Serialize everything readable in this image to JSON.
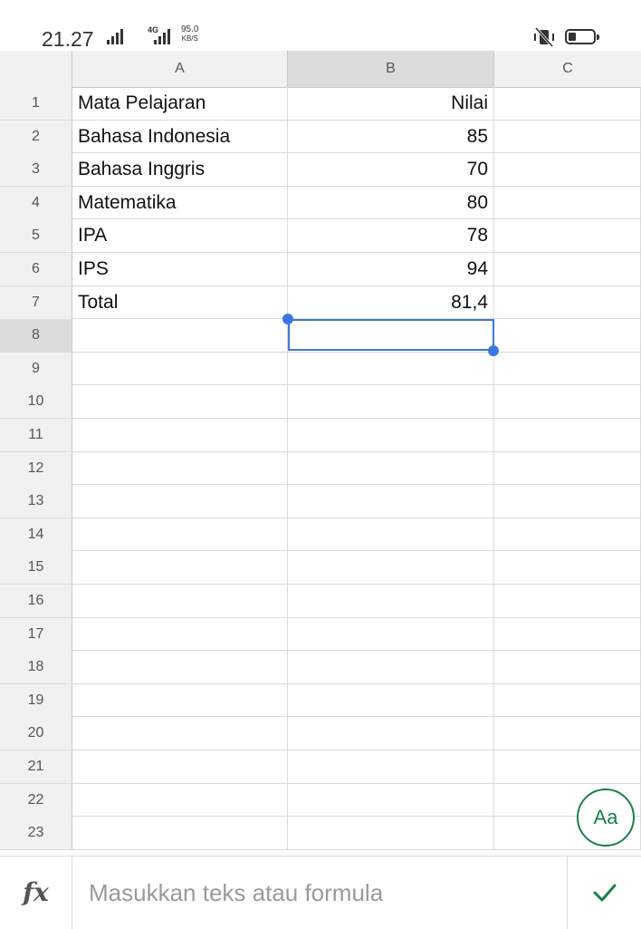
{
  "status_bar": {
    "time": "21.27",
    "network_type": "4G",
    "speed_value": "95.0",
    "speed_unit": "KB/S",
    "icons": [
      "signal-icon",
      "signal-4g-icon",
      "vibrate-icon",
      "battery-icon"
    ]
  },
  "sheet": {
    "columns": [
      "A",
      "B",
      "C"
    ],
    "selected_column": "B",
    "selected_row": "8",
    "rows": [
      {
        "num": "1",
        "a": "Mata Pelajaran",
        "b": "Nilai",
        "c": ""
      },
      {
        "num": "2",
        "a": "Bahasa Indonesia",
        "b": "85",
        "c": ""
      },
      {
        "num": "3",
        "a": "Bahasa Inggris",
        "b": "70",
        "c": ""
      },
      {
        "num": "4",
        "a": "Matematika",
        "b": "80",
        "c": ""
      },
      {
        "num": "5",
        "a": "IPA",
        "b": "78",
        "c": ""
      },
      {
        "num": "6",
        "a": "IPS",
        "b": "94",
        "c": ""
      },
      {
        "num": "7",
        "a": "Total",
        "b": "81,4",
        "c": ""
      },
      {
        "num": "8",
        "a": "",
        "b": "",
        "c": ""
      },
      {
        "num": "9",
        "a": "",
        "b": "",
        "c": ""
      },
      {
        "num": "10",
        "a": "",
        "b": "",
        "c": ""
      },
      {
        "num": "11",
        "a": "",
        "b": "",
        "c": ""
      },
      {
        "num": "12",
        "a": "",
        "b": "",
        "c": ""
      },
      {
        "num": "13",
        "a": "",
        "b": "",
        "c": ""
      },
      {
        "num": "14",
        "a": "",
        "b": "",
        "c": ""
      },
      {
        "num": "15",
        "a": "",
        "b": "",
        "c": ""
      },
      {
        "num": "16",
        "a": "",
        "b": "",
        "c": ""
      },
      {
        "num": "17",
        "a": "",
        "b": "",
        "c": ""
      },
      {
        "num": "18",
        "a": "",
        "b": "",
        "c": ""
      },
      {
        "num": "19",
        "a": "",
        "b": "",
        "c": ""
      },
      {
        "num": "20",
        "a": "",
        "b": "",
        "c": ""
      },
      {
        "num": "21",
        "a": "",
        "b": "",
        "c": ""
      },
      {
        "num": "22",
        "a": "",
        "b": "",
        "c": ""
      },
      {
        "num": "23",
        "a": "",
        "b": "",
        "c": ""
      }
    ]
  },
  "fab": {
    "label": "Aa"
  },
  "formula_bar": {
    "fx_label": "fx",
    "placeholder": "Masukkan teks atau formula",
    "value": ""
  },
  "colors": {
    "accent": "#3a78e0",
    "confirm": "#1a7f4a"
  }
}
